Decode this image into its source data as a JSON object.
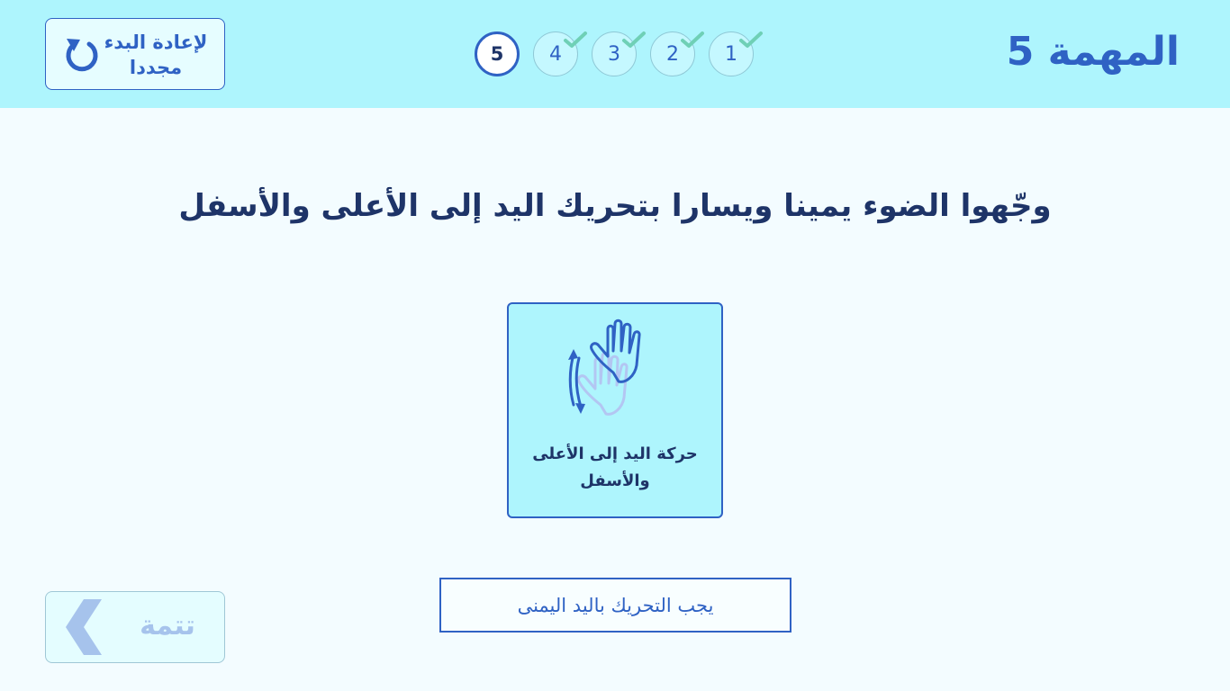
{
  "header": {
    "task_title": "المهمة 5",
    "restart_label": "لإعادة البدء مجددا",
    "steps": [
      {
        "label": "1",
        "state": "done"
      },
      {
        "label": "2",
        "state": "done"
      },
      {
        "label": "3",
        "state": "done"
      },
      {
        "label": "4",
        "state": "done"
      },
      {
        "label": "5",
        "state": "current"
      }
    ]
  },
  "main": {
    "instruction": "وجّهوا الضوء يمينا ويسارا بتحريك اليد إلى الأعلى والأسفل",
    "gesture_card": {
      "icon": "hand-up-down-icon",
      "label": "حركة اليد إلى الأعلى والأسفل"
    },
    "hint": "يجب التحريك باليد اليمنى"
  },
  "footer": {
    "continue_label": "تتمة",
    "continue_enabled": false
  },
  "colors": {
    "header_bg": "#aef5fd",
    "page_bg": "#f3fcff",
    "accent": "#2f62c4",
    "dark_text": "#1e3468",
    "check": "#6fd0b6",
    "disabled": "#a6c3ec"
  }
}
